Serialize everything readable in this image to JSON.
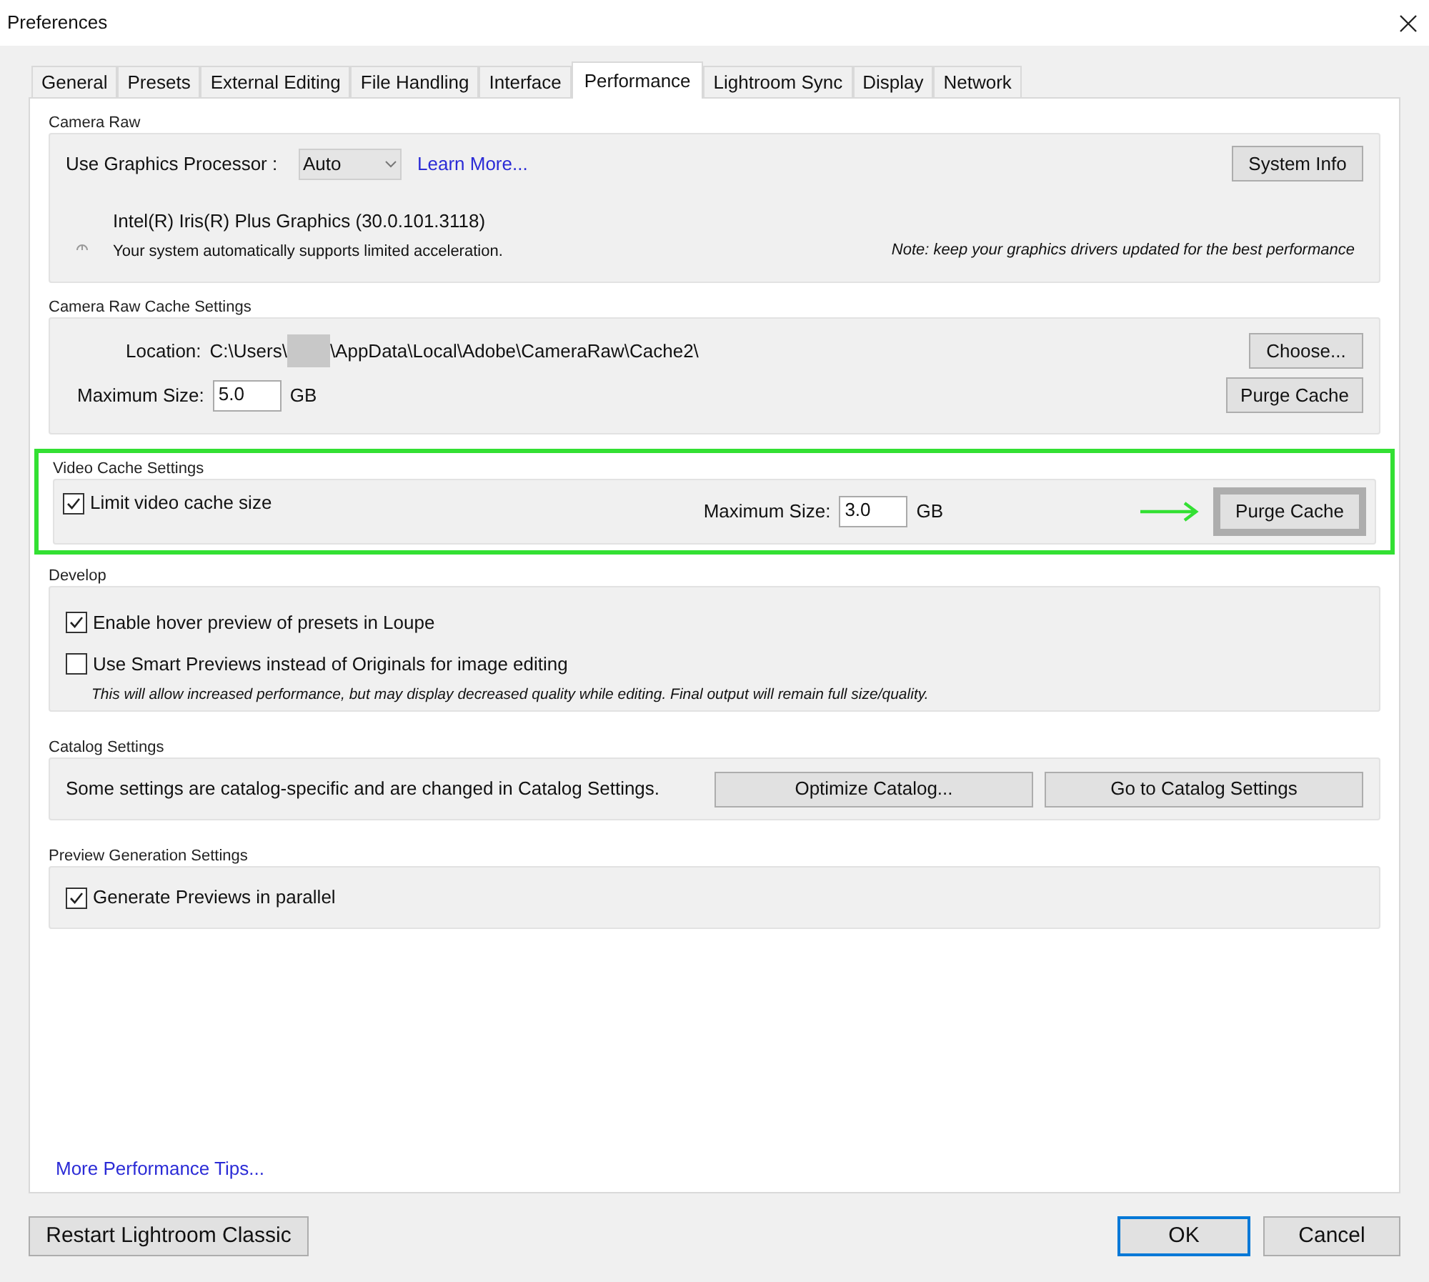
{
  "window": {
    "title": "Preferences"
  },
  "tabs": [
    {
      "label": "General",
      "selected": false
    },
    {
      "label": "Presets",
      "selected": false
    },
    {
      "label": "External Editing",
      "selected": false
    },
    {
      "label": "File Handling",
      "selected": false
    },
    {
      "label": "Interface",
      "selected": false
    },
    {
      "label": "Performance",
      "selected": true
    },
    {
      "label": "Lightroom Sync",
      "selected": false
    },
    {
      "label": "Display",
      "selected": false
    },
    {
      "label": "Network",
      "selected": false
    }
  ],
  "camera_raw": {
    "title": "Camera Raw",
    "gpu_label": "Use Graphics Processor :",
    "gpu_select": "Auto",
    "learn_more": "Learn More...",
    "system_info": "System Info",
    "gpu_name": "Intel(R) Iris(R) Plus Graphics (30.0.101.3118)",
    "gpu_status": "Your system automatically supports limited acceleration.",
    "note": "Note: keep your graphics drivers updated for the best performance"
  },
  "camera_raw_cache": {
    "title": "Camera Raw Cache Settings",
    "location_label": "Location:",
    "location_prefix": "C:\\Users\\",
    "location_suffix": "\\AppData\\Local\\Adobe\\CameraRaw\\Cache2\\",
    "max_label": "Maximum Size:",
    "max_value": "5.0",
    "unit": "GB",
    "choose": "Choose...",
    "purge": "Purge Cache"
  },
  "video_cache": {
    "title": "Video Cache Settings",
    "highlighted": true,
    "limit": {
      "label": "Limit video cache size",
      "checked": true
    },
    "max_label": "Maximum Size:",
    "max_value": "3.0",
    "unit": "GB",
    "purge": {
      "label": "Purge Cache",
      "highlighted": true
    }
  },
  "develop": {
    "title": "Develop",
    "options": [
      {
        "label": "Enable hover preview of presets in Loupe",
        "checked": true
      },
      {
        "label": "Use Smart Previews instead of Originals for image editing",
        "checked": false
      }
    ],
    "hint": "This will allow increased performance, but may display decreased quality while editing. Final output will remain full size/quality."
  },
  "catalog": {
    "title": "Catalog Settings",
    "text": "Some settings are catalog-specific and are changed in Catalog Settings.",
    "buttons": [
      "Optimize Catalog...",
      "Go to Catalog Settings"
    ]
  },
  "preview_generation": {
    "title": "Preview Generation Settings",
    "options": [
      {
        "label": "Generate Previews in parallel",
        "checked": true
      }
    ]
  },
  "more_tips": "More Performance Tips...",
  "footer": {
    "restart": "Restart Lightroom Classic",
    "ok": "OK",
    "cancel": "Cancel"
  }
}
